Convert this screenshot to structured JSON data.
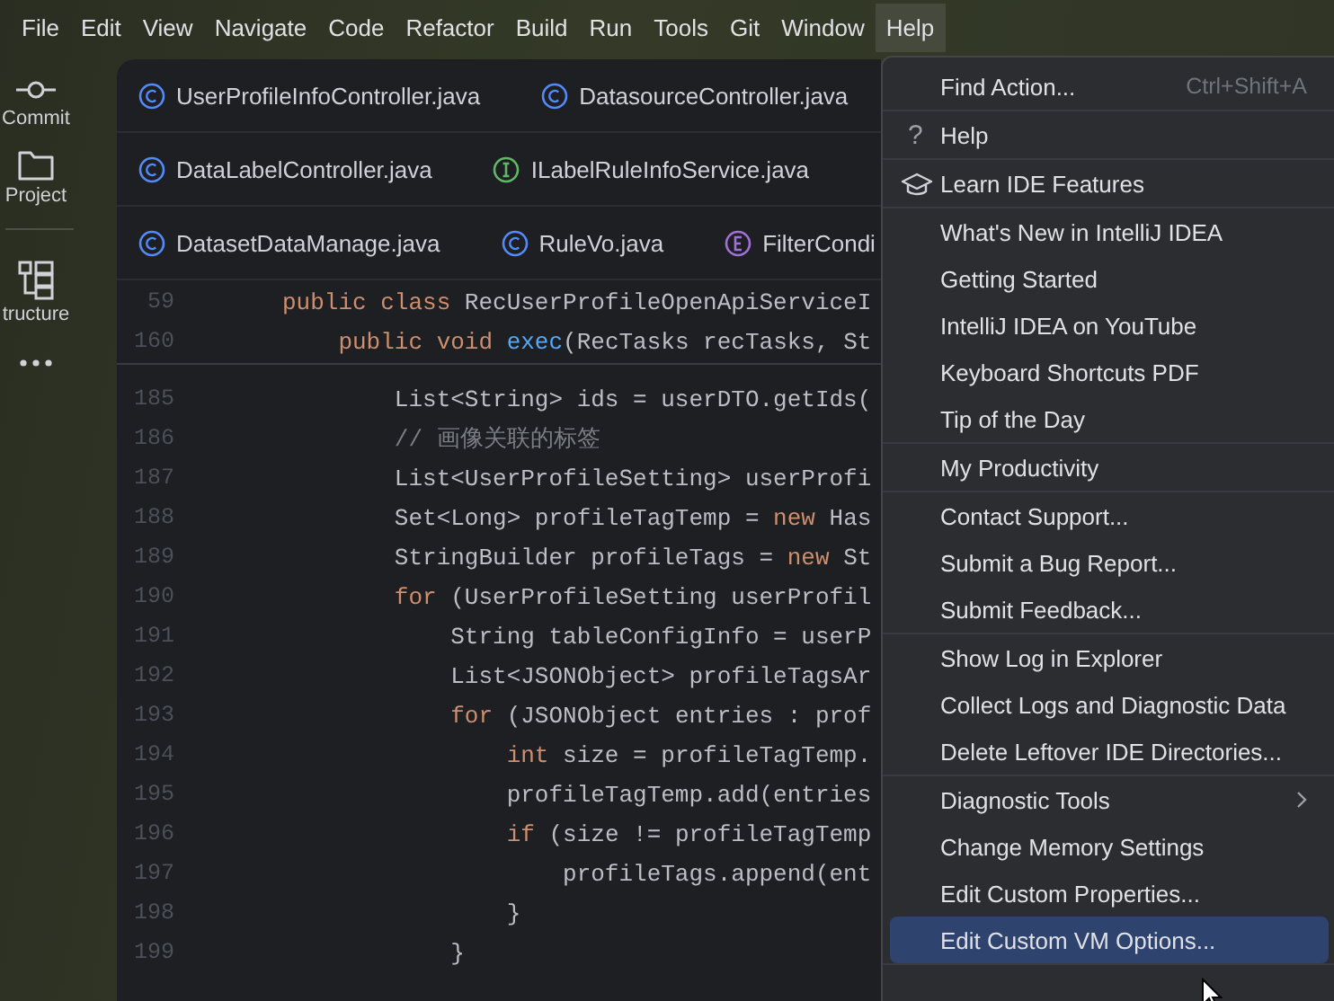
{
  "menubar": [
    {
      "label": "File",
      "selected": false
    },
    {
      "label": "Edit",
      "selected": false
    },
    {
      "label": "View",
      "selected": false
    },
    {
      "label": "Navigate",
      "selected": false
    },
    {
      "label": "Code",
      "selected": false
    },
    {
      "label": "Refactor",
      "selected": false
    },
    {
      "label": "Build",
      "selected": false
    },
    {
      "label": "Run",
      "selected": false
    },
    {
      "label": "Tools",
      "selected": false
    },
    {
      "label": "Git",
      "selected": false
    },
    {
      "label": "Window",
      "selected": false
    },
    {
      "label": "Help",
      "selected": true
    }
  ],
  "sidebar": [
    {
      "kind": "commit",
      "label": "Commit"
    },
    {
      "kind": "folder",
      "label": "Project"
    },
    {
      "kind": "divider"
    },
    {
      "kind": "structure",
      "label": "tructure"
    },
    {
      "kind": "more"
    }
  ],
  "tab_rows": [
    [
      {
        "kind": "class",
        "label": "UserProfileInfoController.java"
      },
      {
        "kind": "class",
        "label": "DatasourceController.java"
      }
    ],
    [
      {
        "kind": "class",
        "label": "DataLabelController.java"
      },
      {
        "kind": "interface",
        "label": "ILabelRuleInfoService.java"
      }
    ],
    [
      {
        "kind": "class",
        "label": "DatasetDataManage.java"
      },
      {
        "kind": "class",
        "label": "RuleVo.java"
      },
      {
        "kind": "enum",
        "label": "FilterCondi"
      }
    ]
  ],
  "sticky_lines": [
    {
      "number": "59",
      "tokens": [
        {
          "kind": "keyword",
          "text": "public class "
        },
        {
          "kind": "plain",
          "text": "RecUserProfileOpenApiServiceI"
        }
      ]
    },
    {
      "number": "160",
      "tokens": [
        {
          "kind": "keyword",
          "text": "    public void "
        },
        {
          "kind": "method",
          "text": "exec"
        },
        {
          "kind": "plain",
          "text": "(RecTasks recTasks, St"
        }
      ]
    }
  ],
  "code_lines": [
    {
      "number": "185",
      "tokens": [
        {
          "kind": "plain",
          "text": "        List<String> ids = userDTO.getIds("
        }
      ]
    },
    {
      "number": "186",
      "tokens": [
        {
          "kind": "comment",
          "text": "        // 画像关联的标签"
        }
      ]
    },
    {
      "number": "187",
      "tokens": [
        {
          "kind": "plain",
          "text": "        List<UserProfileSetting> userProfi"
        }
      ]
    },
    {
      "number": "188",
      "tokens": [
        {
          "kind": "plain",
          "text": "        Set<Long> profileTagTemp = "
        },
        {
          "kind": "keyword",
          "text": "new "
        },
        {
          "kind": "plain",
          "text": "Has"
        }
      ]
    },
    {
      "number": "189",
      "tokens": [
        {
          "kind": "plain",
          "text": "        StringBuilder profileTags = "
        },
        {
          "kind": "keyword",
          "text": "new "
        },
        {
          "kind": "plain",
          "text": "St"
        }
      ]
    },
    {
      "number": "190",
      "tokens": [
        {
          "kind": "keyword",
          "text": "        for "
        },
        {
          "kind": "plain",
          "text": "(UserProfileSetting userProfil"
        }
      ]
    },
    {
      "number": "191",
      "tokens": [
        {
          "kind": "plain",
          "text": "            String tableConfigInfo = userP"
        }
      ]
    },
    {
      "number": "192",
      "tokens": [
        {
          "kind": "plain",
          "text": "            List<JSONObject> profileTagsAr"
        }
      ]
    },
    {
      "number": "193",
      "tokens": [
        {
          "kind": "keyword",
          "text": "            for "
        },
        {
          "kind": "plain",
          "text": "(JSONObject entries : prof"
        }
      ]
    },
    {
      "number": "194",
      "tokens": [
        {
          "kind": "keyword",
          "text": "                int "
        },
        {
          "kind": "plain",
          "text": "size = profileTagTemp."
        }
      ]
    },
    {
      "number": "195",
      "tokens": [
        {
          "kind": "plain",
          "text": "                profileTagTemp.add(entries"
        }
      ]
    },
    {
      "number": "196",
      "tokens": [
        {
          "kind": "keyword",
          "text": "                if "
        },
        {
          "kind": "plain",
          "text": "(size != profileTagTemp"
        }
      ]
    },
    {
      "number": "197",
      "tokens": [
        {
          "kind": "plain",
          "text": "                    profileTags.append(ent"
        }
      ]
    },
    {
      "number": "198",
      "tokens": [
        {
          "kind": "plain",
          "text": "                }"
        }
      ]
    },
    {
      "number": "199",
      "tokens": [
        {
          "kind": "plain",
          "text": "            }"
        }
      ]
    }
  ],
  "help_menu": [
    [
      {
        "kind": "plain",
        "label": "Find Action...",
        "shortcut": "Ctrl+Shift+A",
        "selected": false
      }
    ],
    [
      {
        "kind": "glyph",
        "glyph": "?",
        "label": "Help",
        "selected": false
      }
    ],
    [
      {
        "kind": "cap",
        "label": "Learn IDE Features",
        "selected": false
      }
    ],
    [
      {
        "kind": "plain",
        "label": "What's New in IntelliJ IDEA",
        "selected": false
      },
      {
        "kind": "plain",
        "label": "Getting Started",
        "selected": false
      },
      {
        "kind": "plain",
        "label": "IntelliJ IDEA on YouTube",
        "selected": false
      },
      {
        "kind": "plain",
        "label": "Keyboard Shortcuts PDF",
        "selected": false
      },
      {
        "kind": "plain",
        "label": "Tip of the Day",
        "selected": false
      }
    ],
    [
      {
        "kind": "plain",
        "label": "My Productivity",
        "selected": false
      }
    ],
    [
      {
        "kind": "plain",
        "label": "Contact Support...",
        "selected": false
      },
      {
        "kind": "plain",
        "label": "Submit a Bug Report...",
        "selected": false
      },
      {
        "kind": "plain",
        "label": "Submit Feedback...",
        "selected": false
      }
    ],
    [
      {
        "kind": "plain",
        "label": "Show Log in Explorer",
        "selected": false
      },
      {
        "kind": "plain",
        "label": "Collect Logs and Diagnostic Data",
        "selected": false
      },
      {
        "kind": "plain",
        "label": "Delete Leftover IDE Directories...",
        "selected": false
      }
    ],
    [
      {
        "kind": "submenu",
        "label": "Diagnostic Tools",
        "selected": false
      },
      {
        "kind": "plain",
        "label": "Change Memory Settings",
        "selected": false
      },
      {
        "kind": "plain",
        "label": "Edit Custom Properties...",
        "selected": false
      },
      {
        "kind": "plain",
        "label": "Edit Custom VM Options...",
        "selected": true
      }
    ]
  ]
}
